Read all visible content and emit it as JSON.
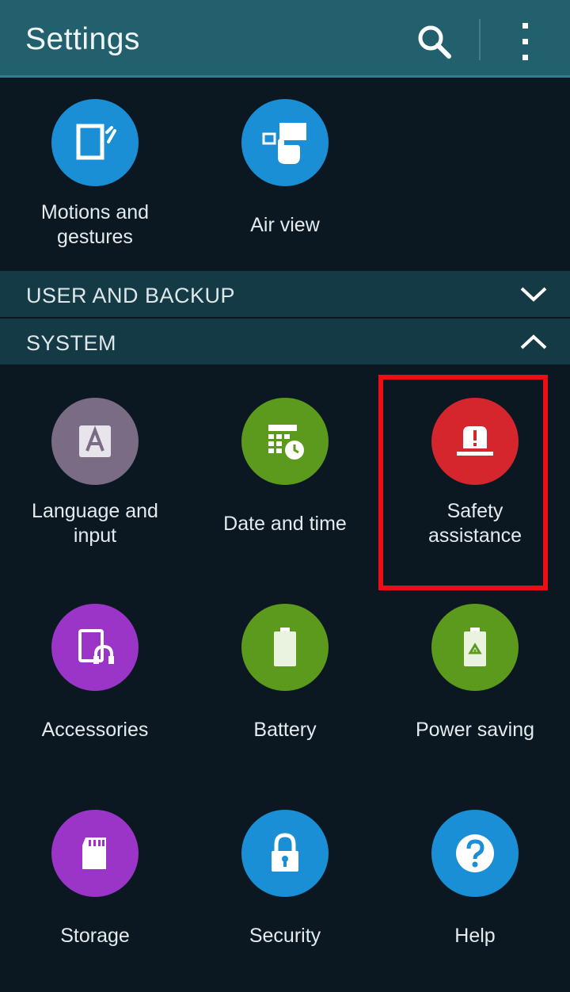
{
  "header": {
    "title": "Settings",
    "search_icon": "search-icon",
    "more_icon": "more-vert-icon"
  },
  "top_items": [
    {
      "label": "Motions and gestures",
      "label_lines": [
        "Motions and",
        "gestures"
      ],
      "icon": "motions-icon",
      "color": "#1a8fd6"
    },
    {
      "label": "Air view",
      "label_lines": [
        "Air view"
      ],
      "icon": "air-view-icon",
      "color": "#1a8fd6"
    }
  ],
  "sections": {
    "user_and_backup": {
      "label": "USER AND BACKUP",
      "state": "collapsed",
      "icon": "chevron-down-icon"
    },
    "system": {
      "label": "SYSTEM",
      "state": "expanded",
      "icon": "chevron-up-icon"
    }
  },
  "system_items": [
    {
      "label_lines": [
        "Language and",
        "input"
      ],
      "icon": "language-icon",
      "color": "#7b6c86"
    },
    {
      "label_lines": [
        "Date and time"
      ],
      "icon": "calendar-clock-icon",
      "color": "#5c9a1e"
    },
    {
      "label_lines": [
        "Safety",
        "assistance"
      ],
      "icon": "safety-alert-icon",
      "color": "#d4262c",
      "highlighted": true
    },
    {
      "label_lines": [
        "Accessories"
      ],
      "icon": "accessories-icon",
      "color": "#9a35c7"
    },
    {
      "label_lines": [
        "Battery"
      ],
      "icon": "battery-icon",
      "color": "#5c9a1e"
    },
    {
      "label_lines": [
        "Power saving"
      ],
      "icon": "power-saving-icon",
      "color": "#5c9a1e"
    },
    {
      "label_lines": [
        "Storage"
      ],
      "icon": "sd-card-icon",
      "color": "#9a35c7"
    },
    {
      "label_lines": [
        "Security"
      ],
      "icon": "lock-icon",
      "color": "#1a8fd6"
    },
    {
      "label_lines": [
        "Help"
      ],
      "icon": "help-icon",
      "color": "#1a8fd6"
    }
  ],
  "colors": {
    "header_bg": "#22606d",
    "section_bg": "#143a46",
    "page_bg": "#0b1822",
    "highlight_border": "#ec0e14"
  }
}
